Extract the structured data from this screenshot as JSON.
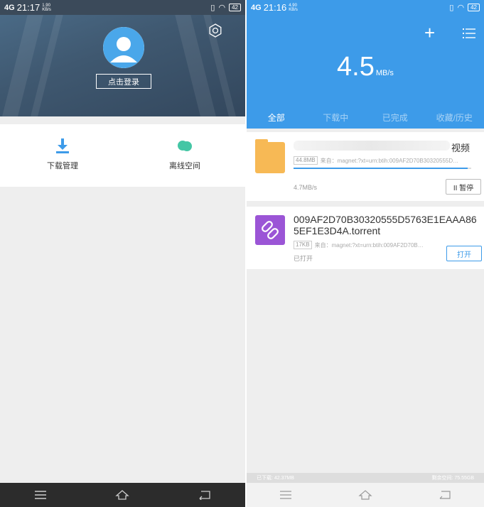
{
  "left_screen": {
    "status_bar": {
      "signal": "4G",
      "time": "21:17",
      "net_speed_value": "1.90",
      "net_speed_unit": "KB/s",
      "battery": "42"
    },
    "header": {
      "login_label": "点击登录"
    },
    "tools": [
      {
        "label": "下载管理",
        "icon": "download-icon",
        "color": "#3d9be9"
      },
      {
        "label": "离线空间",
        "icon": "cloud-icon",
        "color": "#44c6a5"
      }
    ]
  },
  "right_screen": {
    "status_bar": {
      "signal": "4G",
      "time": "21:16",
      "net_speed_value": "4.90",
      "net_speed_unit": "KB/s",
      "battery": "42"
    },
    "header": {
      "speed_value": "4.5",
      "speed_unit": "MB/s"
    },
    "tabs": [
      "全部",
      "下载中",
      "已完成",
      "收藏/历史"
    ],
    "active_tab": "全部",
    "tasks": [
      {
        "name_visible": "视频",
        "size": "44.8MB",
        "source": "来自：magnet:?xt=urn:btih:009AF2D70B30320555D…",
        "progress": 0.98,
        "rate": "4.7MB/s",
        "action": "II 暂停"
      },
      {
        "name": "009AF2D70B30320555D5763E1EAAA865EF1E3D4A.torrent",
        "size": "17KB",
        "source": "来自：magnet:?xt=urn:btih:009AF2D70B…",
        "status": "已打开",
        "action": "打开"
      }
    ],
    "footer": {
      "downloaded": "已下载: 42.37MB",
      "free": "剩余空间: 75.55GB"
    }
  },
  "colors": {
    "accent": "#3d9be9",
    "header_dark": "#3f5870",
    "folder": "#f7b955",
    "torrent": "#9b55d6"
  }
}
